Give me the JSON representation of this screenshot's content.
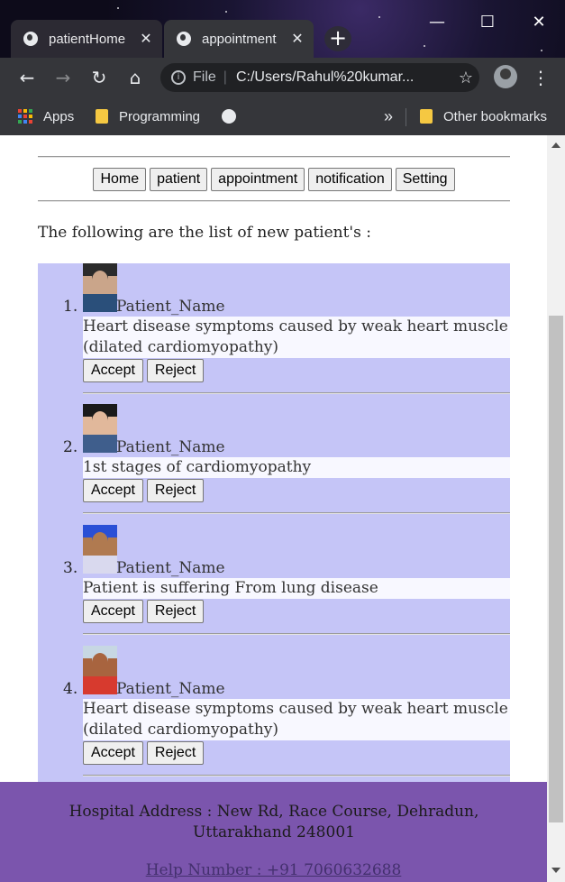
{
  "browser": {
    "tabs": [
      {
        "title": "patientHome",
        "close": "✕"
      },
      {
        "title": "appointment",
        "close": "✕"
      }
    ],
    "new_tab": "+",
    "window_controls": {
      "minimize": "—",
      "maximize": "☐",
      "close": "✕"
    },
    "nav": {
      "back": "←",
      "forward": "→",
      "reload": "↻",
      "home": "⌂"
    },
    "address": {
      "scheme": "File",
      "separator": "|",
      "url": "C:/Users/Rahul%20kumar...",
      "bookmark_star": "☆",
      "info": "i"
    },
    "menu": "⋮",
    "bookmarks": {
      "apps": "Apps",
      "programming": "Programming",
      "overflow": "»",
      "other": "Other bookmarks"
    },
    "app_colors": [
      "#ea4335",
      "#fbbc05",
      "#34a853",
      "#4285f4",
      "#ea4335",
      "#fbbc05",
      "#34a853",
      "#4285f4",
      "#ea4335"
    ]
  },
  "nav_buttons": [
    "Home",
    "patient",
    "appointment",
    "notification",
    "Setting"
  ],
  "intro": "The following are the list of new patient's :",
  "patients": [
    {
      "number": "1.",
      "name": "Patient_Name",
      "description": "Heart disease symptoms caused by weak heart muscle (dilated cardiomyopathy)",
      "accept": "Accept",
      "reject": "Reject"
    },
    {
      "number": "2.",
      "name": "Patient_Name",
      "description": "1st stages of cardiomyopathy",
      "accept": "Accept",
      "reject": "Reject"
    },
    {
      "number": "3.",
      "name": "Patient_Name",
      "description": "Patient is suffering From lung disease",
      "accept": "Accept",
      "reject": "Reject"
    },
    {
      "number": "4.",
      "name": "Patient_Name",
      "description": "Heart disease symptoms caused by weak heart muscle (dilated cardiomyopathy)",
      "accept": "Accept",
      "reject": "Reject"
    }
  ],
  "footer": {
    "address": "Hospital Address : New Rd, Race Course, Dehradun, Uttarakhand 248001",
    "help": "Help Number : +91 7060632688"
  },
  "colors": {
    "list_bg": "#c5c5f7",
    "footer_bg": "#7b55ad",
    "desc_bg": "#f8f8ff"
  }
}
